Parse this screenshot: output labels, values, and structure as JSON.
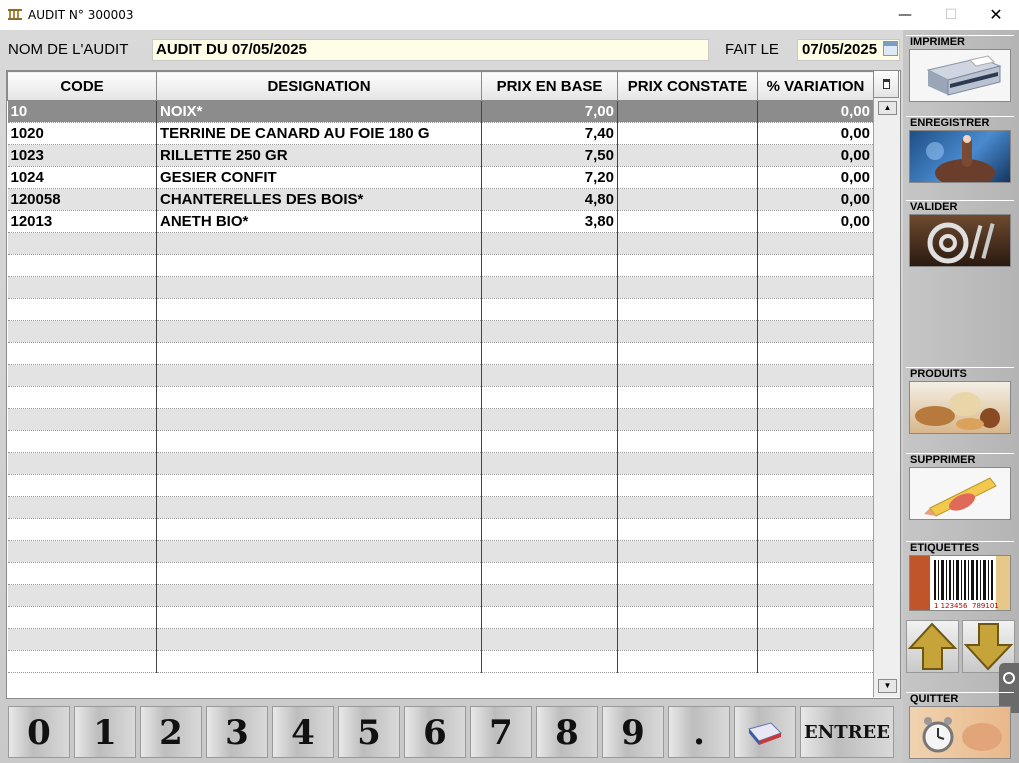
{
  "window": {
    "title": "AUDIT N° 300003",
    "minimize": "—",
    "maximize": "☐",
    "close": "✕"
  },
  "header": {
    "name_label": "NOM DE L'AUDIT",
    "name_value": "AUDIT DU 07/05/2025",
    "date_label": "FAIT LE",
    "date_value": "07/05/2025"
  },
  "table": {
    "columns": [
      "CODE",
      "DESIGNATION",
      "PRIX EN BASE",
      "PRIX CONSTATE",
      "% VARIATION"
    ],
    "rows": [
      [
        "10",
        "NOIX*",
        "7,00",
        "",
        "0,00"
      ],
      [
        "1020",
        "TERRINE DE CANARD AU FOIE 180 G",
        "7,40",
        "",
        "0,00"
      ],
      [
        "1023",
        "RILLETTE 250 GR",
        "7,50",
        "",
        "0,00"
      ],
      [
        "1024",
        "GESIER CONFIT",
        "7,20",
        "",
        "0,00"
      ],
      [
        "120058",
        "CHANTERELLES DES BOIS*",
        "4,80",
        "",
        "0,00"
      ],
      [
        "12013",
        "ANETH BIO*",
        "3,80",
        "",
        "0,00"
      ]
    ],
    "selected_row": 0,
    "total_visible_rows": 26
  },
  "sidebar": {
    "print": "IMPRIMER",
    "save": "ENREGISTRER",
    "validate": "VALIDER",
    "products": "PRODUITS",
    "delete": "SUPPRIMER",
    "labels": "ETIQUETTES",
    "barcode_left": "1 123456",
    "barcode_right": "789101",
    "quit": "QUITTER"
  },
  "keypad": {
    "keys": [
      "0",
      "1",
      "2",
      "3",
      "4",
      "5",
      "6",
      "7",
      "8",
      "9",
      "."
    ],
    "enter": "ENTREE"
  },
  "colors": {
    "selected_row": "#8c8c8c",
    "alt_row": "#e3e3e3",
    "field_bg": "#fffde6",
    "arrow_gold": "#b8962a"
  }
}
